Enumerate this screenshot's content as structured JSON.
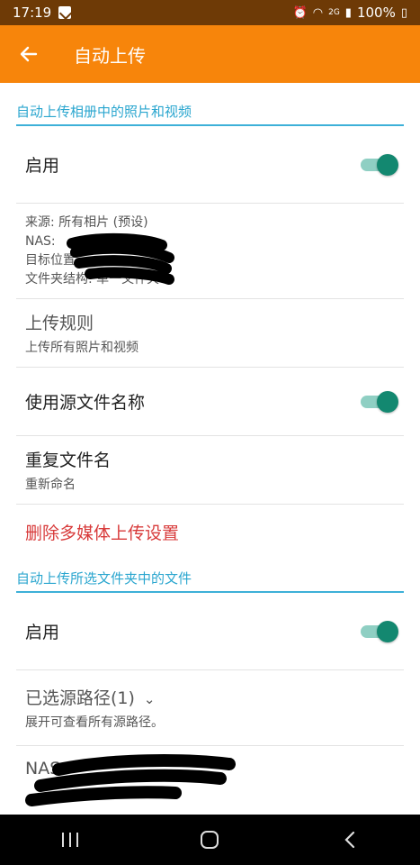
{
  "status_bar": {
    "time": "17:19",
    "battery": "100%",
    "network": "2G"
  },
  "app_bar": {
    "title": "自动上传",
    "back_icon": "arrow-left-icon"
  },
  "sections": [
    {
      "header": "自动上传相册中的照片和视频",
      "enable_label": "启用",
      "enable_on": true,
      "info_lines": [
        "来源: 所有相片 (预设)",
        "NAS:",
        "目标位置",
        "文件夹结构: 单一文件夹"
      ],
      "upload_rule_title": "上传规则",
      "upload_rule_sub": "上传所有照片和视频",
      "source_name_label": "使用源文件名称",
      "source_name_on": true,
      "duplicate_title": "重复文件名",
      "duplicate_sub": "重新命名",
      "delete_label": "删除多媒体上传设置"
    },
    {
      "header": "自动上传所选文件夹中的文件",
      "enable_label": "启用",
      "enable_on": true,
      "selected_paths_title": "已选源路径(1)",
      "selected_paths_sub": "展开可查看所有源路径。",
      "nas_label": "NAS:"
    }
  ],
  "colors": {
    "app_bar": "#f7850b",
    "status_bar": "#6e3a06",
    "accent": "#2aa6cf",
    "toggle_on": "#138870",
    "danger": "#d83b3b"
  }
}
